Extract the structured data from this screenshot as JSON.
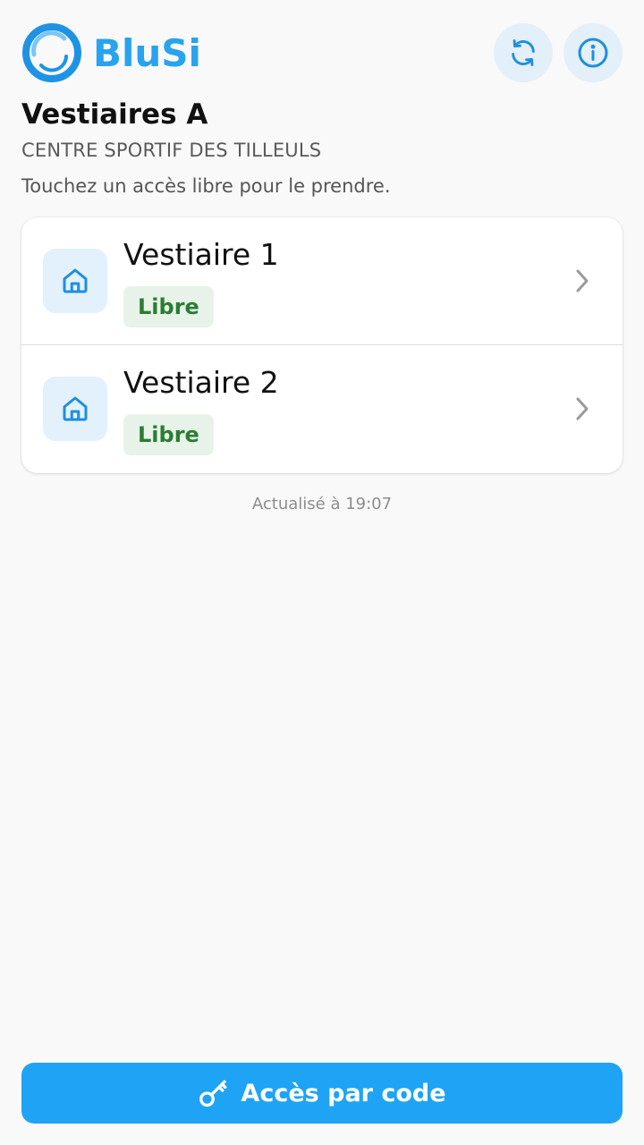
{
  "app": {
    "name": "BluSi",
    "accent": "#27a3ef"
  },
  "header": {
    "refresh_icon": "refresh-icon",
    "info_icon": "info-icon"
  },
  "page": {
    "title": "Vestiaires A",
    "subtitle": "CENTRE SPORTIF DES TILLEULS",
    "hint": "Touchez un accès libre pour le prendre."
  },
  "rooms": [
    {
      "name": "Vestiaire 1",
      "status": "Libre",
      "icon": "home-icon"
    },
    {
      "name": "Vestiaire 2",
      "status": "Libre",
      "icon": "home-icon"
    }
  ],
  "updated": "Actualisé à 19:07",
  "code_button": {
    "label": "Accès par code",
    "icon": "key-icon"
  },
  "colors": {
    "status_free_bg": "#e7f3e8",
    "status_free_text": "#2a7d33",
    "button": "#1fa3f5"
  }
}
